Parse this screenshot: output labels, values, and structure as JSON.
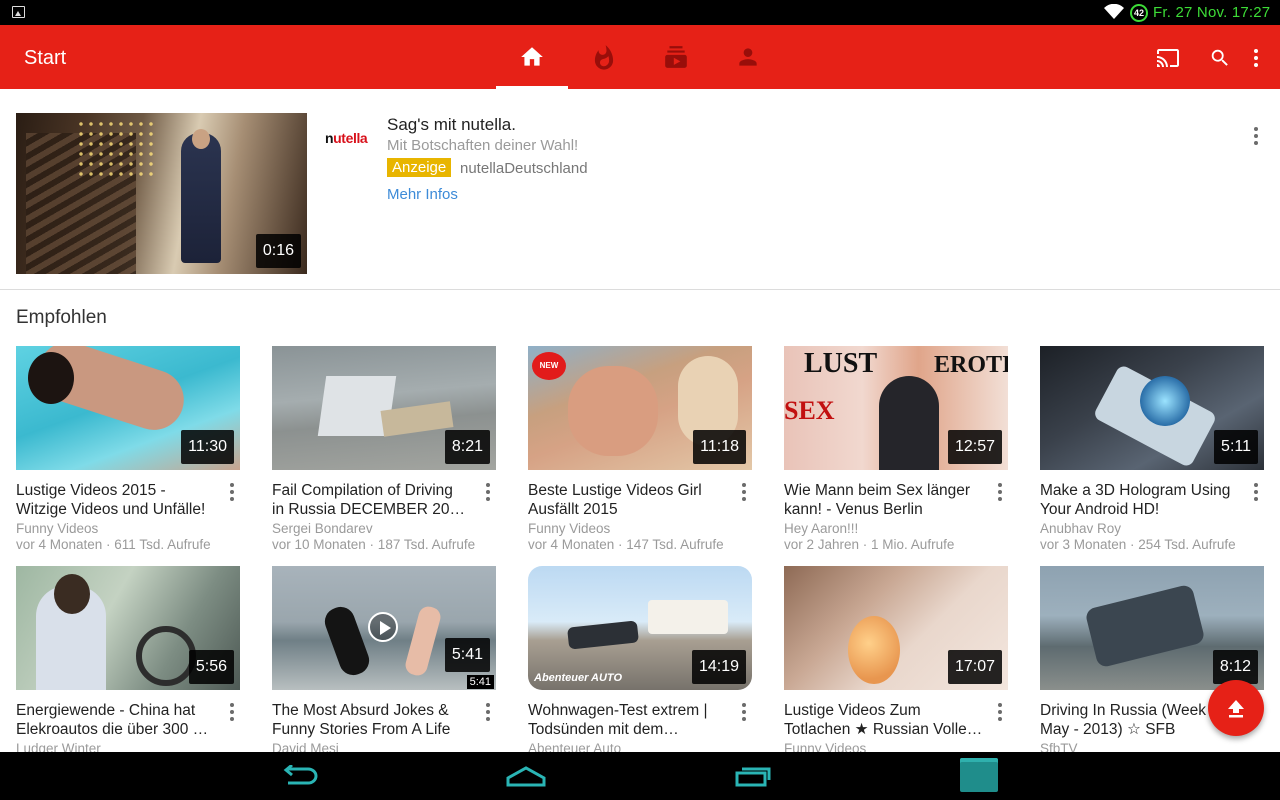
{
  "status_bar": {
    "battery": "42",
    "clock": "Fr. 27 Nov. 17:27"
  },
  "app_bar": {
    "title": "Start"
  },
  "ad": {
    "duration": "0:16",
    "logo": "nutella",
    "title": "Sag's mit nutella.",
    "subtitle": "Mit Botschaften deiner Wahl!",
    "badge": "Anzeige",
    "channel": "nutellaDeutschland",
    "more_info": "Mehr Infos"
  },
  "section": {
    "title": "Empfohlen"
  },
  "videos": [
    {
      "title1": "Lustige Videos 2015 -",
      "title2": "Witzige Videos und Unfälle!",
      "channel": "Funny Videos",
      "meta": "vor 4 Monaten · 611 Tsd. Aufrufe",
      "duration": "11:30"
    },
    {
      "title1": "Fail Compilation of Driving",
      "title2": "in Russia DECEMBER 2014…",
      "channel": "Sergei Bondarev",
      "meta": "vor 10 Monaten · 187 Tsd. Aufrufe",
      "duration": "8:21"
    },
    {
      "title1": "Beste Lustige Videos Girl",
      "title2": "Ausfällt 2015",
      "channel": "Funny Videos",
      "meta": "vor 4 Monaten · 147 Tsd. Aufrufe",
      "duration": "11:18",
      "sticker": "NEW"
    },
    {
      "title1": "Wie Mann beim Sex länger",
      "title2": "kann! - Venus Berlin",
      "channel": "Hey Aaron!!!",
      "meta": "vor 2 Jahren · 1 Mio. Aufrufe",
      "duration": "12:57",
      "thumb_words": [
        "LUST",
        "EROTIK",
        "SEX"
      ]
    },
    {
      "title1": "Make a 3D Hologram Using",
      "title2": "Your Android HD!",
      "channel": "Anubhav Roy",
      "meta": "vor 3 Monaten · 254 Tsd. Aufrufe",
      "duration": "5:11"
    },
    {
      "title1": "Energiewende - China hat",
      "title2": "Elekroautos die über 300 K…",
      "channel": "Ludger Winter",
      "meta": "",
      "duration": "5:56"
    },
    {
      "title1": "The Most Absurd Jokes &",
      "title2": "Funny Stories From A Life",
      "channel": "David Mesi",
      "meta": "",
      "duration": "5:41",
      "small_duration": "5:41"
    },
    {
      "title1": "Wohnwagen-Test extrem |",
      "title2": "Todsünden mit dem…",
      "channel": "Abenteuer Auto",
      "meta": "",
      "duration": "14:19",
      "thumb_text": "Abenteuer AUTO"
    },
    {
      "title1": "Lustige Videos Zum",
      "title2": "Totlachen ★ Russian Volle…",
      "channel": "Funny Videos",
      "meta": "",
      "duration": "17:07"
    },
    {
      "title1": "Driving In Russia (Week",
      "title2": "May - 2013) ☆ SFB",
      "channel": "SfbTV",
      "meta": "",
      "duration": "8:12"
    }
  ],
  "colors": {
    "brand_red": "#e62117",
    "nav_teal": "#2ab5b5",
    "status_green": "#3ddc37",
    "ad_badge": "#e8b500",
    "link_blue": "#3d8bd8"
  }
}
